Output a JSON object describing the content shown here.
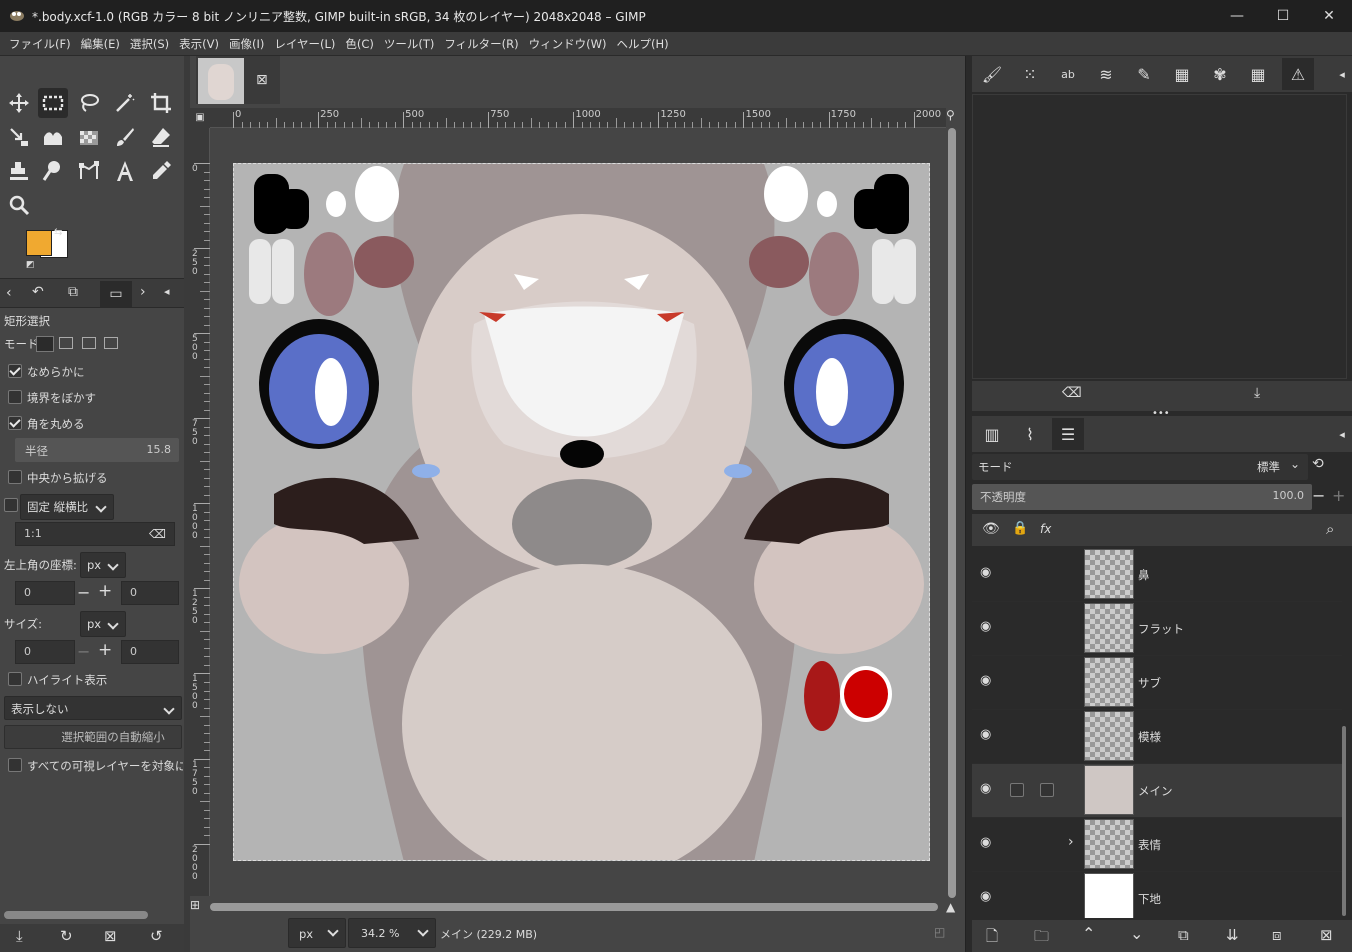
{
  "window": {
    "title": "*.body.xcf-1.0 (RGB カラー 8 bit ノンリニア整数, GIMP built-in sRGB, 34 枚のレイヤー) 2048x2048 – GIMP",
    "minimize": "—",
    "maximize": "☐",
    "close": "✕"
  },
  "menu": [
    "ファイル(F)",
    "編集(E)",
    "選択(S)",
    "表示(V)",
    "画像(I)",
    "レイヤー(L)",
    "色(C)",
    "ツール(T)",
    "フィルター(R)",
    "ウィンドウ(W)",
    "ヘルプ(H)"
  ],
  "tool_options": {
    "title": "矩形選択",
    "mode_label": "モード:",
    "antialias": {
      "label": "なめらかに",
      "checked": true
    },
    "feather": {
      "label": "境界をぼかす",
      "checked": false
    },
    "rounded": {
      "label": "角を丸める",
      "checked": true
    },
    "radius": {
      "label": "半径",
      "value": "15.8"
    },
    "expand_center": {
      "label": "中央から拡げる",
      "checked": false
    },
    "fixed": {
      "label": "固定",
      "select": "縦横比",
      "checked": false
    },
    "ratio_value": "1:1",
    "position": {
      "label": "左上角の座標:",
      "unit": "px",
      "x": "0",
      "y": "0"
    },
    "size": {
      "label": "サイズ:",
      "unit": "px",
      "w": "0",
      "h": "0"
    },
    "highlight": {
      "label": "ハイライト表示",
      "checked": false
    },
    "guides": "表示しない",
    "auto_shrink": "選択範囲の自動縮小",
    "sample_merged": {
      "label": "すべての可視レイヤーを対象にする",
      "checked": false
    }
  },
  "colors": {
    "fg": "#f0a930",
    "bg": "#ffffff"
  },
  "ruler": {
    "top": [
      "0",
      "250",
      "500",
      "750",
      "1000",
      "1250",
      "1500",
      "1750",
      "2000"
    ],
    "left": [
      "0",
      "250",
      "500",
      "750",
      "1000",
      "1250",
      "1500",
      "1750",
      "2000"
    ]
  },
  "statusbar": {
    "unit": "px",
    "zoom": "34.2 %",
    "info": "メイン (229.2 MB)"
  },
  "layers_panel": {
    "mode_label": "モード",
    "mode_value": "標準",
    "opacity_label": "不透明度",
    "opacity_value": "100.0",
    "layers": [
      {
        "name": "鼻",
        "selected": false
      },
      {
        "name": "フラット",
        "selected": false
      },
      {
        "name": "サブ",
        "selected": false
      },
      {
        "name": "模様",
        "selected": false
      },
      {
        "name": "メイン",
        "selected": true
      },
      {
        "name": "表情",
        "selected": false,
        "group": true
      },
      {
        "name": "下地",
        "selected": false
      }
    ]
  }
}
